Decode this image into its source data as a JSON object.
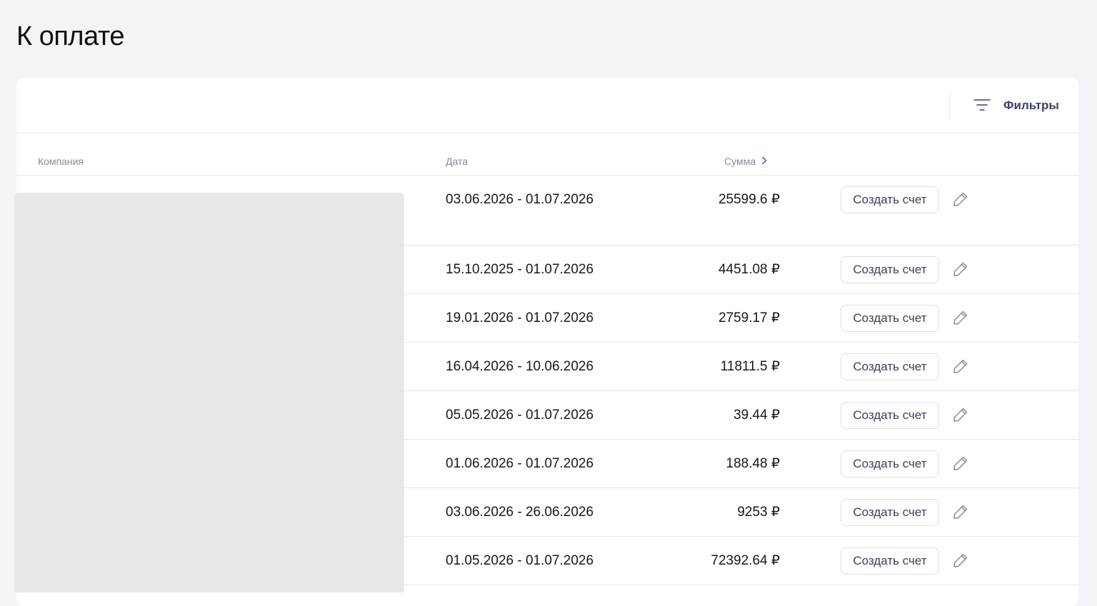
{
  "page": {
    "title": "К оплате"
  },
  "toolbar": {
    "filters_label": "Фильтры",
    "filters_icon": "filter-lines-icon"
  },
  "table": {
    "columns": {
      "company": "Компания",
      "date": "Дата",
      "sum": "Сумма",
      "sum_sort_icon": "chevron-right-icon"
    },
    "action_label": "Создать счет",
    "edit_icon": "pencil-icon",
    "rows": [
      {
        "date": "03.06.2026 - 01.07.2026",
        "sum": "25599.6 ₽"
      },
      {
        "date": "15.10.2025 - 01.07.2026",
        "sum": "4451.08 ₽"
      },
      {
        "date": "19.01.2026 - 01.07.2026",
        "sum": "2759.17 ₽"
      },
      {
        "date": "16.04.2026 - 10.06.2026",
        "sum": "11811.5 ₽"
      },
      {
        "date": "05.05.2026 - 01.07.2026",
        "sum": "39.44 ₽"
      },
      {
        "date": "01.06.2026 - 01.07.2026",
        "sum": "188.48 ₽"
      },
      {
        "date": "03.06.2026 - 26.06.2026",
        "sum": "9253 ₽"
      },
      {
        "date": "01.05.2026 - 01.07.2026",
        "sum": "72392.64 ₽"
      }
    ]
  },
  "colors": {
    "background": "#f3f4f7",
    "card": "#ffffff",
    "accent": "#3d4260",
    "link": "#3b6fd8",
    "placeholder": "#e8e8ec"
  }
}
